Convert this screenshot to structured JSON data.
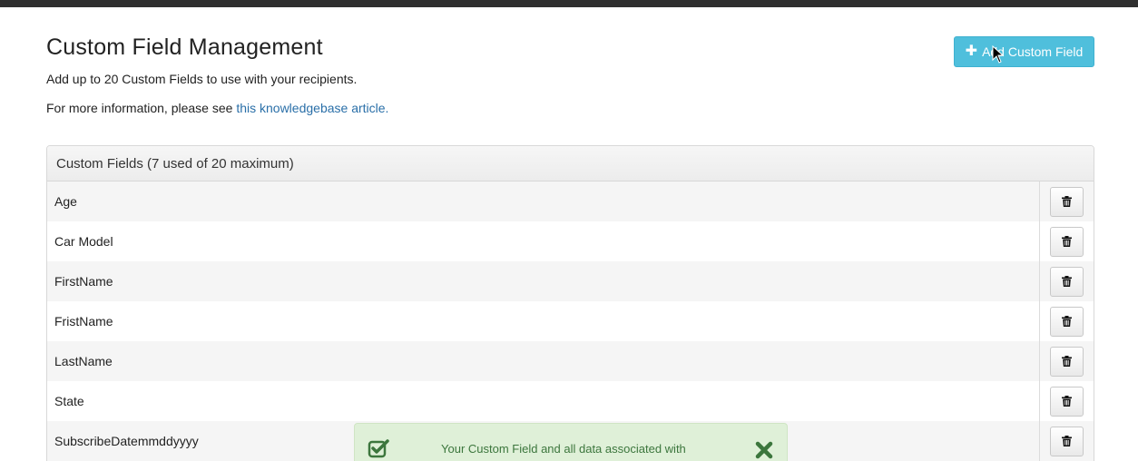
{
  "header": {
    "title": "Custom Field Management",
    "subtitle": "Add up to 20 Custom Fields to use with your recipients.",
    "info_prefix": "For more information, please see ",
    "info_link": "this knowledgebase article.",
    "add_button_label": "Add Custom Field"
  },
  "panel": {
    "title": "Custom Fields (7 used of 20 maximum)",
    "fields": [
      {
        "name": "Age"
      },
      {
        "name": "Car Model"
      },
      {
        "name": "FirstName"
      },
      {
        "name": "FristName"
      },
      {
        "name": "LastName"
      },
      {
        "name": "State"
      },
      {
        "name": "SubscribeDatemmddyyyy"
      }
    ],
    "row_action_icon": "trash-icon"
  },
  "toast": {
    "message": "Your Custom Field and all data associated with",
    "icon": "check-square-icon",
    "close_icon": "close-icon"
  },
  "colors": {
    "accent": "#4fbfdc",
    "link": "#2a6fa8",
    "success_bg": "#dff0d8",
    "success_text": "#3c763d",
    "topbar": "#2f2f2f"
  }
}
